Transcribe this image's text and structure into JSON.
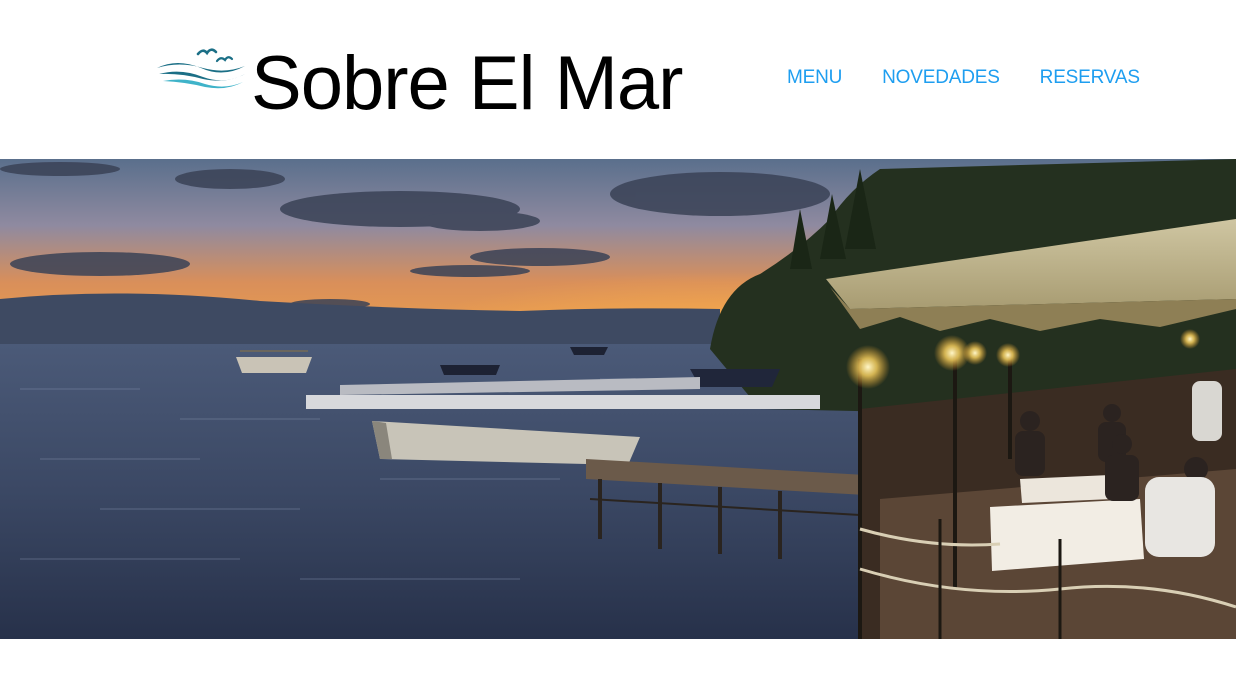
{
  "brand": {
    "name": "Sobre El Mar",
    "logo_icon": "waves-birds-icon",
    "colors": {
      "wave_dark": "#1b6f86",
      "wave_light": "#3fb3c9"
    }
  },
  "nav": {
    "items": [
      {
        "label": "MENU"
      },
      {
        "label": "NOVEDADES"
      },
      {
        "label": "RESERVAS"
      }
    ],
    "color": "#1e9ef0"
  },
  "hero": {
    "image": "lakeside-restaurant-sunset-photo"
  }
}
